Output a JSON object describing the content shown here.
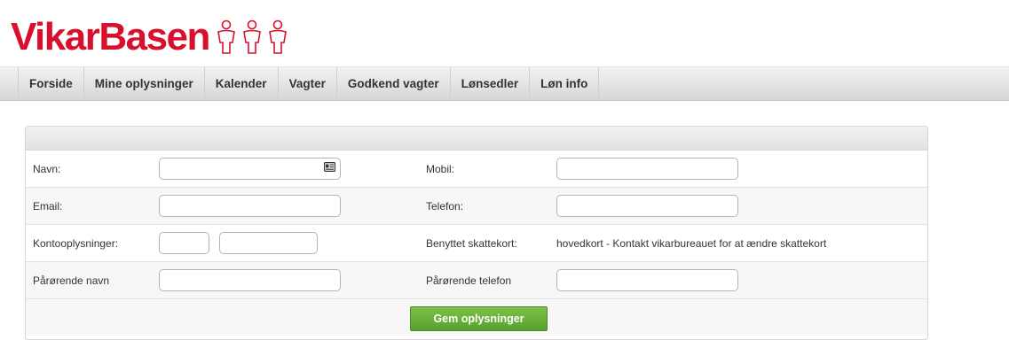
{
  "logo": {
    "text": "VikarBasen",
    "icon": "people-figures-logo",
    "color": "#d8102d"
  },
  "nav": {
    "items": [
      "Forside",
      "Mine oplysninger",
      "Kalender",
      "Vagter",
      "Godkend vagter",
      "Lønsedler",
      "Løn info"
    ]
  },
  "form": {
    "rows": [
      {
        "left_label": "Navn:",
        "left_value": "",
        "right_label": "Mobil:",
        "right_value": ""
      },
      {
        "left_label": "Email:",
        "left_value": "",
        "right_label": "Telefon:",
        "right_value": ""
      },
      {
        "left_label": "Kontooplysninger:",
        "reg_value": "",
        "account_value": "",
        "right_label": "Benyttet skattekort:",
        "right_info": "hovedkort - Kontakt vikarbureauet for at ændre skattekort"
      },
      {
        "left_label": "Pårørende navn",
        "left_value": "",
        "right_label": "Pårørende telefon",
        "right_value": ""
      }
    ],
    "contact_card_icon": "contact-card-icon",
    "save_label": "Gem oplysninger",
    "save_color": "#68b13a"
  }
}
